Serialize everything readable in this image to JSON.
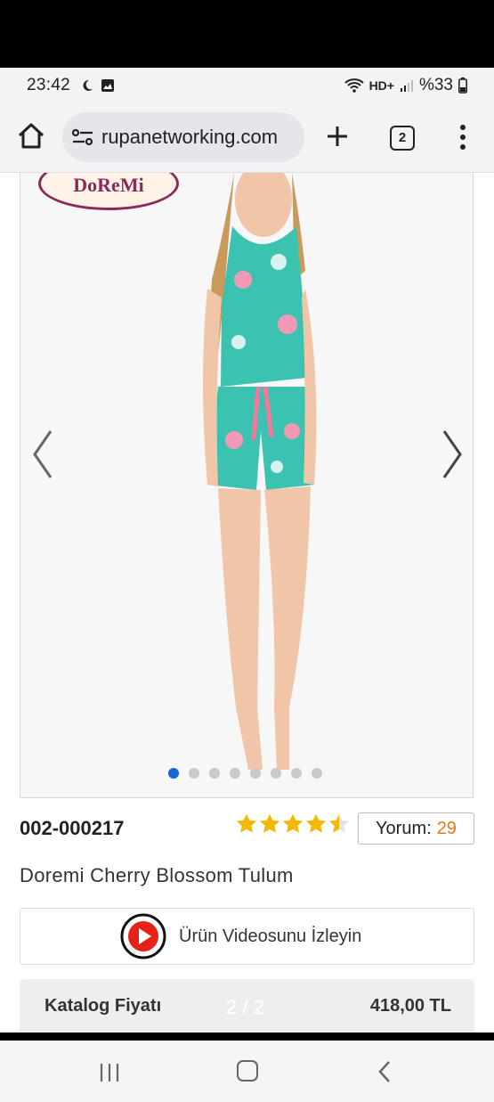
{
  "status_bar": {
    "time": "23:42",
    "network": "HD+",
    "battery": "%33",
    "icons": [
      "moon-icon",
      "gallery-icon",
      "wifi-icon",
      "signal-icon",
      "battery-icon"
    ]
  },
  "browser": {
    "url": "rupanetworking.com",
    "tab_count": "2",
    "icons": [
      "home-icon",
      "site-settings-icon",
      "new-tab-icon",
      "tabs-icon",
      "menu-icon"
    ]
  },
  "product": {
    "logo_text": "DoReMi",
    "image_count": 8,
    "active_image": 1,
    "sku": "002-000217",
    "rating": 4.5,
    "rating_max": 5,
    "review_label": "Yorum:",
    "review_count": "29",
    "title": "Doremi Cherry Blossom Tulum",
    "video_label": "Ürün Videosunu İzleyin",
    "price_label": "Katalog Fiyatı",
    "price_value": "418,00 TL",
    "page_indicator": "2 / 2"
  },
  "colors": {
    "accent": "#1565d8",
    "star": "#f5b800",
    "review_count": "#e7781c",
    "video_red": "#e62117",
    "outfit": "#3cc2b0"
  }
}
